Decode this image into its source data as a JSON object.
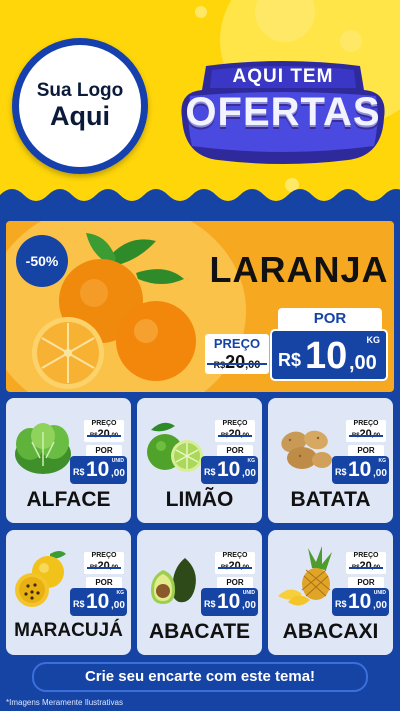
{
  "header": {
    "logo_line1": "Sua Logo",
    "logo_line2": "Aqui",
    "badge_top": "AQUI TEM",
    "badge_main": "OFERTAS"
  },
  "colors": {
    "yellow": "#ffd60a",
    "blue": "#1544a5",
    "orange": "#f7a821",
    "card": "#dfe6f5"
  },
  "featured": {
    "discount": "-50%",
    "name": "LARANJA",
    "preco_label": "PREÇO",
    "old_currency": "R$",
    "old_int": "20",
    "old_cents": ",00",
    "por_label": "POR",
    "currency": "R$",
    "price_int": "10",
    "price_cents": ",00",
    "unit": "KG"
  },
  "products": [
    {
      "name": "ALFACE",
      "icon": "lettuce-icon",
      "preco_label": "PREÇO",
      "old_currency": "R$",
      "old_int": "20",
      "old_cents": ",00",
      "por_label": "POR",
      "currency": "R$",
      "price_int": "10",
      "price_cents": ",00",
      "unit": "UNID"
    },
    {
      "name": "LIMÃO",
      "icon": "lime-icon",
      "preco_label": "PREÇO",
      "old_currency": "R$",
      "old_int": "20",
      "old_cents": ",00",
      "por_label": "POR",
      "currency": "R$",
      "price_int": "10",
      "price_cents": ",00",
      "unit": "KG"
    },
    {
      "name": "BATATA",
      "icon": "potato-icon",
      "preco_label": "PREÇO",
      "old_currency": "R$",
      "old_int": "20",
      "old_cents": ",00",
      "por_label": "POR",
      "currency": "R$",
      "price_int": "10",
      "price_cents": ",00",
      "unit": "KG"
    },
    {
      "name": "MARACUJÁ",
      "icon": "passion-fruit-icon",
      "preco_label": "PREÇO",
      "old_currency": "R$",
      "old_int": "20",
      "old_cents": ",00",
      "por_label": "POR",
      "currency": "R$",
      "price_int": "10",
      "price_cents": ",00",
      "unit": "KG"
    },
    {
      "name": "ABACATE",
      "icon": "avocado-icon",
      "preco_label": "PREÇO",
      "old_currency": "R$",
      "old_int": "20",
      "old_cents": ",00",
      "por_label": "POR",
      "currency": "R$",
      "price_int": "10",
      "price_cents": ",00",
      "unit": "UNID"
    },
    {
      "name": "ABACAXI",
      "icon": "pineapple-icon",
      "preco_label": "PREÇO",
      "old_currency": "R$",
      "old_int": "20",
      "old_cents": ",00",
      "por_label": "POR",
      "currency": "R$",
      "price_int": "10",
      "price_cents": ",00",
      "unit": "UNID"
    }
  ],
  "cta": "Crie seu encarte com este tema!",
  "footnote": "*Imagens Meramente Ilustrativas"
}
